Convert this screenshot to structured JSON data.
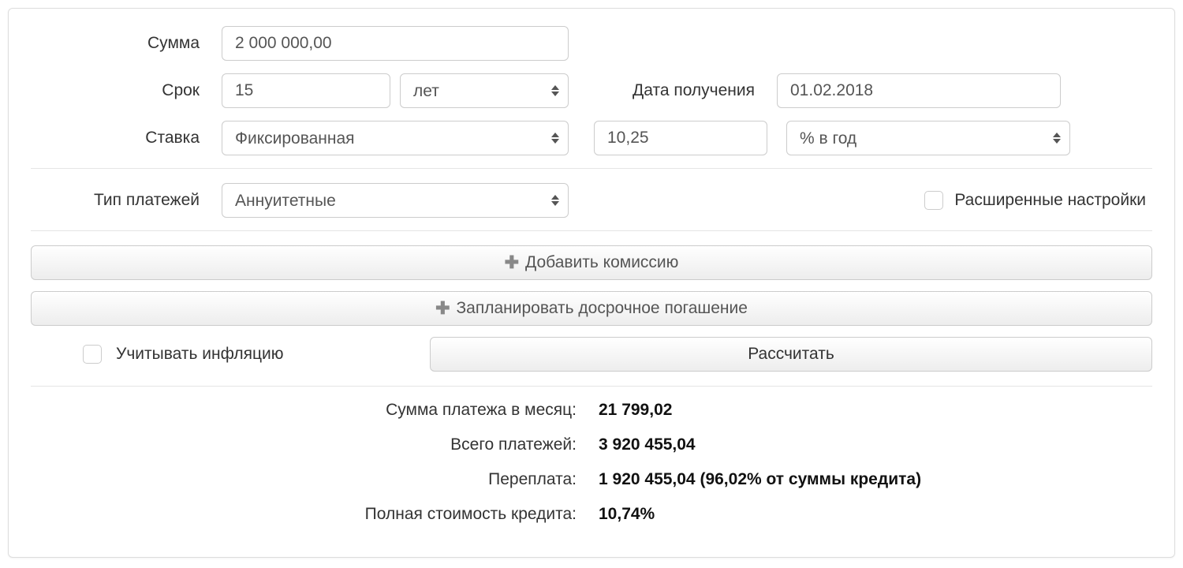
{
  "form": {
    "amount": {
      "label": "Сумма",
      "value": "2 000 000,00"
    },
    "term": {
      "label": "Срок",
      "value": "15",
      "unit": "лет"
    },
    "date": {
      "label": "Дата получения",
      "value": "01.02.2018"
    },
    "rate": {
      "label": "Ставка",
      "type": "Фиксированная",
      "value": "10,25",
      "unit": "% в год"
    },
    "payment_type": {
      "label": "Тип платежей",
      "value": "Аннуитетные"
    },
    "advanced": {
      "label": "Расширенные настройки"
    },
    "add_commission": "Добавить комиссию",
    "early_payment": "Запланировать досрочное погашение",
    "inflation": {
      "label": "Учитывать инфляцию"
    },
    "calc_btn": "Рассчитать"
  },
  "results": {
    "monthly": {
      "label": "Сумма платежа в месяц:",
      "value": "21 799,02"
    },
    "total": {
      "label": "Всего платежей:",
      "value": "3 920 455,04"
    },
    "overpay": {
      "label": "Переплата:",
      "value": "1 920 455,04 (96,02% от суммы кредита)"
    },
    "fullcost": {
      "label": "Полная стоимость кредита:",
      "value": "10,74%"
    }
  }
}
